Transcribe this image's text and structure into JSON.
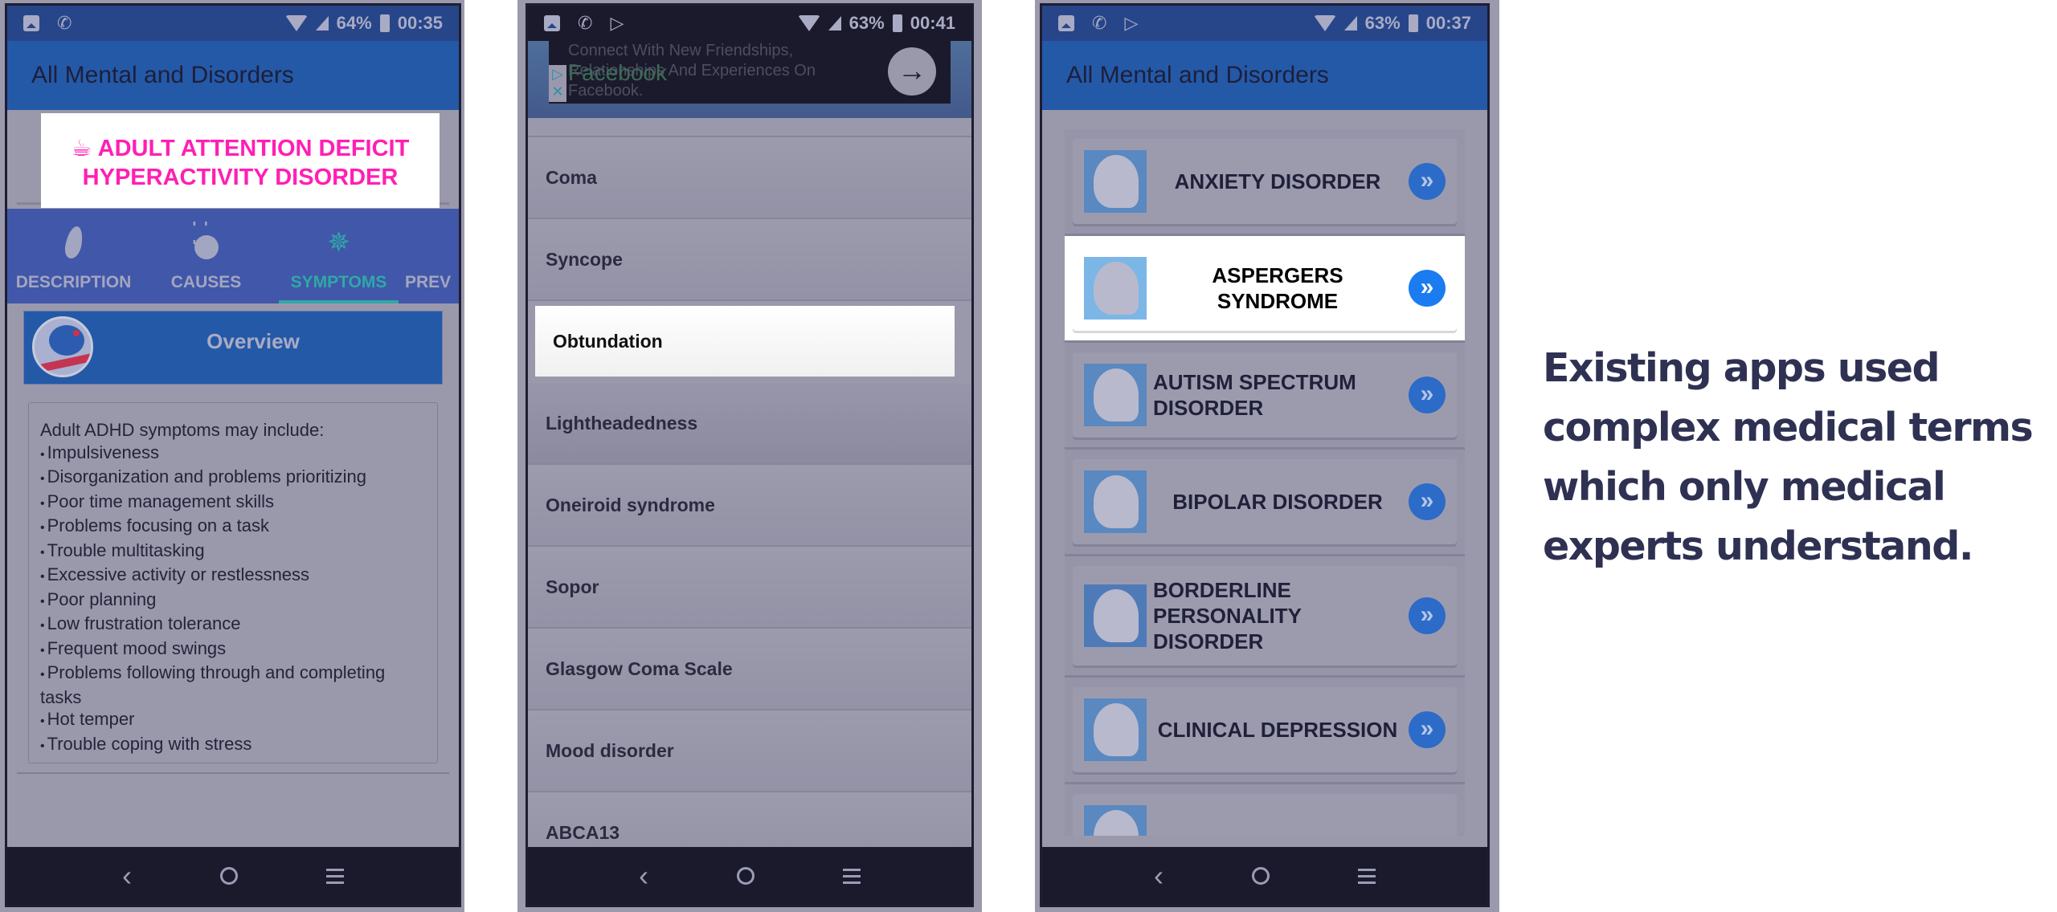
{
  "phone1": {
    "status": {
      "battery": "64%",
      "time": "00:35"
    },
    "appbar_title": "All Mental and Disorders",
    "disorder_title": "☕ ADULT ATTENTION DEFICIT HYPERACTIVITY DISORDER",
    "tabs": [
      {
        "label": "DESCRIPTION",
        "icon": "flame-icon",
        "active": false
      },
      {
        "label": "CAUSES",
        "icon": "lightbulb-icon",
        "active": false
      },
      {
        "label": "SYMPTOMS",
        "icon": "symptoms-icon",
        "active": true
      },
      {
        "label": "PREV",
        "icon": "",
        "active": false
      }
    ],
    "section_title": "Overview",
    "content_intro": "Adult ADHD symptoms may include:",
    "symptoms": [
      "Impulsiveness",
      "Disorganization and problems prioritizing",
      "Poor time management skills",
      "Problems focusing on a task",
      "Trouble multitasking",
      "Excessive activity or restlessness",
      "Poor planning",
      "Low frustration tolerance",
      "Frequent mood swings",
      "Problems following through and completing tasks",
      "Hot temper",
      "Trouble coping with stress"
    ]
  },
  "phone2": {
    "status": {
      "battery": "63%",
      "time": "00:41"
    },
    "ad": {
      "text": "Connect With New Friendships, Relationships And Experiences On Facebook.",
      "brand": "Facebook",
      "choices_glyph": "▷",
      "close_glyph": "✕",
      "cta_glyph": "→"
    },
    "items": [
      {
        "label": "Coma",
        "selected": false
      },
      {
        "label": "Syncope",
        "selected": false
      },
      {
        "label": "Obtundation",
        "selected": true
      },
      {
        "label": "Lightheadedness",
        "selected": false
      },
      {
        "label": "Oneiroid syndrome",
        "selected": false
      },
      {
        "label": "Sopor",
        "selected": false
      },
      {
        "label": "Glasgow Coma Scale",
        "selected": false
      },
      {
        "label": "Mood disorder",
        "selected": false
      },
      {
        "label": "ABCA13",
        "selected": false
      }
    ]
  },
  "phone3": {
    "status": {
      "battery": "63%",
      "time": "00:37"
    },
    "appbar_title": "All Mental and Disorders",
    "items": [
      {
        "label": "ANXIETY DISORDER",
        "highlight": false,
        "thumb_color": "#5a88c0"
      },
      {
        "label": "ASPERGERS SYNDROME",
        "highlight": true,
        "thumb_color": "#7cb6e6"
      },
      {
        "label": "AUTISM SPECTRUM DISORDER",
        "highlight": false,
        "thumb_color": "#5a88c0"
      },
      {
        "label": "BIPOLAR DISORDER",
        "highlight": false,
        "thumb_color": "#5a88c0"
      },
      {
        "label": "BORDERLINE PERSONALITY DISORDER",
        "highlight": false,
        "thumb_color": "#4f7ab8"
      },
      {
        "label": "CLINICAL DEPRESSION",
        "highlight": false,
        "thumb_color": "#5a88c0"
      },
      {
        "label": "",
        "highlight": false,
        "thumb_color": "#5a88c0"
      }
    ],
    "go_glyph": "»"
  },
  "navbar": {
    "back_glyph": "‹"
  },
  "caption": "Existing apps used complex medical terms which only medical experts understand.",
  "colors": {
    "appbar": "#2459a8",
    "tabbar": "#4157a9",
    "active_tab": "#2fa8a6",
    "title_pink": "#ff1fb4",
    "caption": "#2f3153",
    "go_button": "#1a7cf0"
  }
}
